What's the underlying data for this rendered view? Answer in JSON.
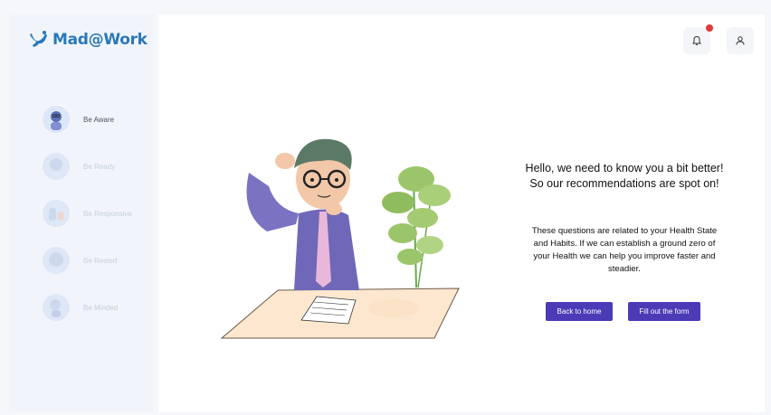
{
  "app": {
    "logo_text": "Mad@Work"
  },
  "sidebar": {
    "items": [
      {
        "label": "Be Aware",
        "active": true
      },
      {
        "label": "Be Ready",
        "active": false
      },
      {
        "label": "Be Responsive",
        "active": false
      },
      {
        "label": "Be Rested",
        "active": false
      },
      {
        "label": "Be Minded",
        "active": false
      }
    ]
  },
  "header": {
    "notification_icon": "bell-icon",
    "profile_icon": "user-icon",
    "has_notification": true
  },
  "main": {
    "headline": "Hello, we need to know you a bit better! So our recommendations are spot on!",
    "description": "These questions are related to your Health State and Habits. If we can establish a ground zero of your Health we can help you improve faster and steadier.",
    "back_button": "Back to home",
    "form_button": "Fill out the form"
  },
  "colors": {
    "brand": "#2a78b8",
    "accent": "#4b3bb7",
    "notification": "#e53935"
  }
}
